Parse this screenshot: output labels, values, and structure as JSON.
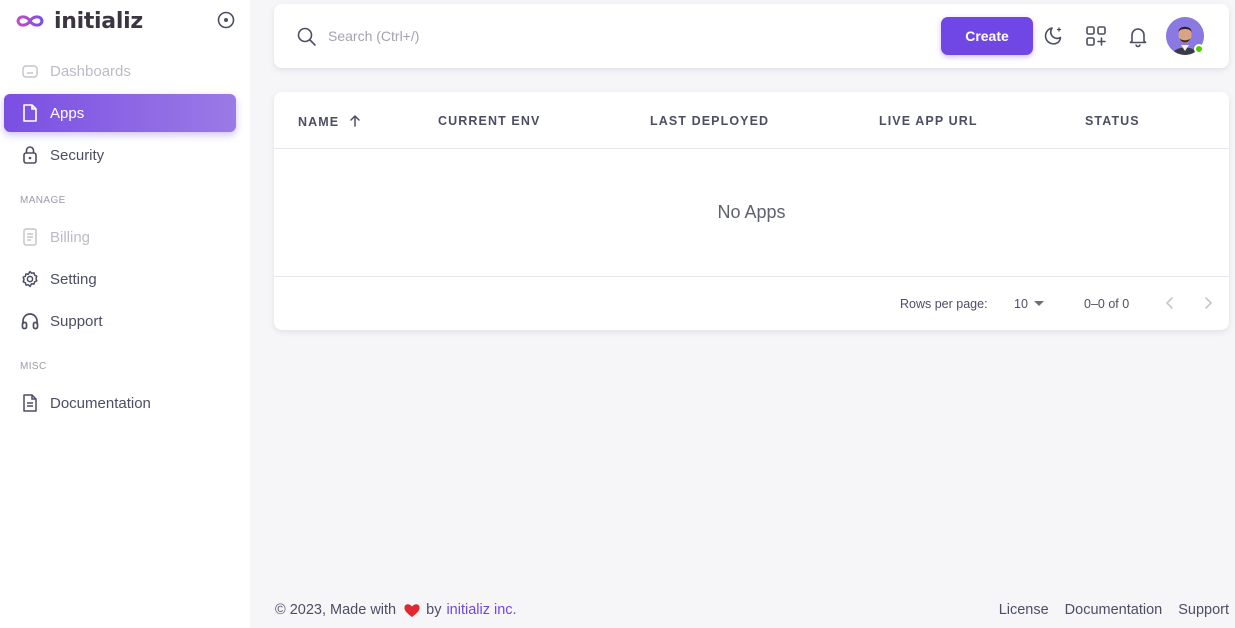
{
  "brand": {
    "name": "initializ"
  },
  "sidebar": {
    "items": [
      {
        "label": "Dashboards"
      },
      {
        "label": "Apps"
      },
      {
        "label": "Security"
      },
      {
        "label": "Billing"
      },
      {
        "label": "Setting"
      },
      {
        "label": "Support"
      },
      {
        "label": "Documentation"
      }
    ],
    "sections": {
      "manage": "MANAGE",
      "misc": "MISC"
    }
  },
  "topbar": {
    "search_placeholder": "Search (Ctrl+/)",
    "create_label": "Create"
  },
  "table": {
    "columns": [
      "NAME",
      "CURRENT ENV",
      "LAST DEPLOYED",
      "LIVE APP URL",
      "STATUS"
    ],
    "empty_text": "No Apps",
    "rows_per_page_label": "Rows per page:",
    "rows_per_page_value": "10",
    "range_text": "0–0 of 0"
  },
  "footer": {
    "left_prefix": "© 2023, Made with",
    "left_by": "by",
    "left_link": "initializ inc.",
    "links": [
      "License",
      "Documentation",
      "Support"
    ]
  },
  "colors": {
    "accent": "#7047e5",
    "heart": "#e0282e",
    "online": "#56ca00"
  }
}
